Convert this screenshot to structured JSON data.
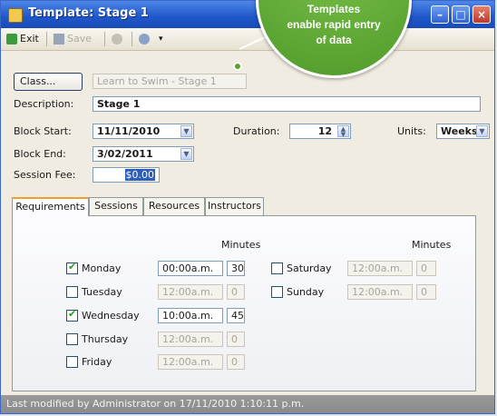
{
  "window": {
    "title": "Template: Stage 1"
  },
  "toolbar": {
    "exit_label": "Exit",
    "save_label": "Save"
  },
  "callout": {
    "line1": "Templates",
    "line2": "enable rapid entry",
    "line3": "of data"
  },
  "form": {
    "class_button": "Class...",
    "class_value": "Learn to Swim - Stage 1",
    "description_label": "Description:",
    "description_value": "Stage 1",
    "block_start_label": "Block Start:",
    "block_start_value": "11/11/2010",
    "block_end_label": "Block End:",
    "block_end_value": "3/02/2011",
    "duration_label": "Duration:",
    "duration_value": "12",
    "units_label": "Units:",
    "units_value": "Weeks",
    "session_fee_label": "Session Fee:",
    "session_fee_value": "$0.00"
  },
  "tabs": [
    "Requirements",
    "Sessions",
    "Resources",
    "Instructors"
  ],
  "requirements": {
    "minutes_header": "Minutes",
    "weekdays": [
      {
        "day": "Monday",
        "checked": true,
        "time": "00:00a.m.",
        "minutes": "30"
      },
      {
        "day": "Tuesday",
        "checked": false,
        "time": "12:00a.m.",
        "minutes": "0"
      },
      {
        "day": "Wednesday",
        "checked": true,
        "time": "10:00a.m.",
        "minutes": "45"
      },
      {
        "day": "Thursday",
        "checked": false,
        "time": "12:00a.m.",
        "minutes": "0"
      },
      {
        "day": "Friday",
        "checked": false,
        "time": "12:00a.m.",
        "minutes": "0"
      }
    ],
    "weekend": [
      {
        "day": "Saturday",
        "checked": false,
        "time": "12:00a.m.",
        "minutes": "0"
      },
      {
        "day": "Sunday",
        "checked": false,
        "time": "12:00a.m.",
        "minutes": "0"
      }
    ]
  },
  "status": {
    "text": "Last modified by Administrator  on 17/11/2010 1:10:11 p.m."
  }
}
